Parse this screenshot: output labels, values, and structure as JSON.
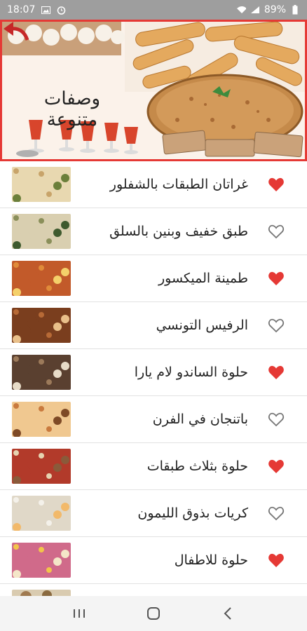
{
  "status_bar": {
    "time": "18:07",
    "battery": "89%"
  },
  "banner": {
    "title_line1": "وصفات",
    "title_line2": "متنوعة"
  },
  "colors": {
    "favorite": "#e53935",
    "banner_border": "#e53935"
  },
  "recipes": [
    {
      "title": "غراتان الطبقات بالشفلور",
      "favorite": true,
      "thumb_icon": "gratin-photo"
    },
    {
      "title": "طبق خفيف وبنين بالسلق",
      "favorite": false,
      "thumb_icon": "chard-dish-photo"
    },
    {
      "title": "طمينة الميكسور",
      "favorite": true,
      "thumb_icon": "tamina-photo"
    },
    {
      "title": "الرفيس التونسي",
      "favorite": false,
      "thumb_icon": "rfiss-photo"
    },
    {
      "title": "حلوة الساندو لام يارا",
      "favorite": true,
      "thumb_icon": "sandwich-sweet-photo"
    },
    {
      "title": "باتنجان في الفرن",
      "favorite": false,
      "thumb_icon": "eggplant-photo"
    },
    {
      "title": "حلوة بثلاث طبقات",
      "favorite": true,
      "thumb_icon": "layered-sweet-photo"
    },
    {
      "title": "كريات بذوق الليمون",
      "favorite": false,
      "thumb_icon": "lemon-balls-photo"
    },
    {
      "title": "حلوة للاطفال",
      "favorite": true,
      "thumb_icon": "kids-sweet-photo"
    }
  ],
  "nav": {
    "recent": "recent-apps-icon",
    "home": "home-icon",
    "back": "back-icon"
  }
}
